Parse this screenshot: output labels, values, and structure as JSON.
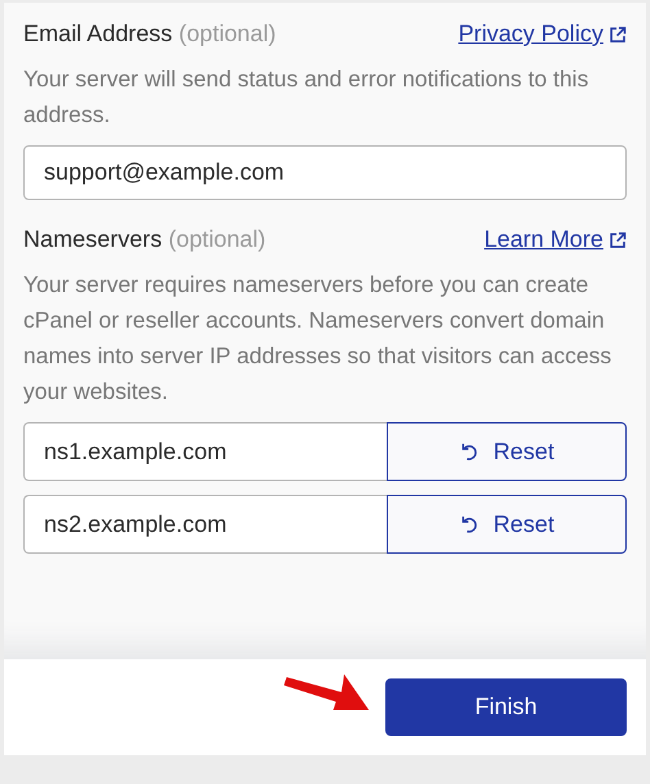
{
  "email": {
    "label": "Email Address",
    "optional": "(optional)",
    "link": "Privacy Policy",
    "description": "Your server will send status and error notifications to this address.",
    "value": "support@example.com"
  },
  "nameservers": {
    "label": "Nameservers",
    "optional": "(optional)",
    "link": "Learn More",
    "description": "Your server requires nameservers before you can create cPanel or reseller accounts. Nameservers convert domain names into server IP addresses so that visitors can access your websites.",
    "fields": [
      {
        "value": "ns1.example.com",
        "button": "Reset"
      },
      {
        "value": "ns2.example.com",
        "button": "Reset"
      }
    ]
  },
  "footer": {
    "button": "Finish"
  }
}
